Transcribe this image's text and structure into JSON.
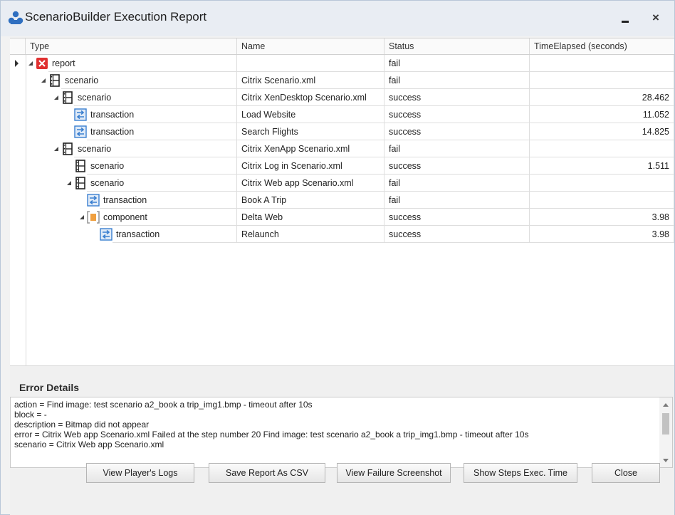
{
  "window": {
    "title": "ScenarioBuilder Execution Report",
    "minimize_icon": "minimize-icon",
    "close_icon": "×"
  },
  "grid": {
    "columns": [
      "Type",
      "Name",
      "Status",
      "TimeElapsed (seconds)"
    ],
    "rows": [
      {
        "type": "report",
        "icon": "error-icon",
        "name": "",
        "status": "fail",
        "time": ""
      },
      {
        "type": "scenario",
        "icon": "film-icon",
        "name": "Citrix Scenario.xml",
        "status": "fail",
        "time": ""
      },
      {
        "type": "scenario",
        "icon": "film-icon",
        "name": "Citrix XenDesktop Scenario.xml",
        "status": "success",
        "time": "28.462"
      },
      {
        "type": "transaction",
        "icon": "transaction-icon",
        "name": "Load Website",
        "status": "success",
        "time": "11.052"
      },
      {
        "type": "transaction",
        "icon": "transaction-icon",
        "name": "Search Flights",
        "status": "success",
        "time": "14.825"
      },
      {
        "type": "scenario",
        "icon": "film-icon",
        "name": "Citrix XenApp Scenario.xml",
        "status": "fail",
        "time": ""
      },
      {
        "type": "scenario",
        "icon": "film-icon",
        "name": "Citrix Log in Scenario.xml",
        "status": "success",
        "time": "1.511"
      },
      {
        "type": "scenario",
        "icon": "film-icon",
        "name": "Citrix Web app Scenario.xml",
        "status": "fail",
        "time": ""
      },
      {
        "type": "transaction",
        "icon": "transaction-icon",
        "name": "Book A Trip",
        "status": "fail",
        "time": ""
      },
      {
        "type": "component",
        "icon": "component-icon",
        "name": "Delta Web",
        "status": "success",
        "time": "3.98"
      },
      {
        "type": "transaction",
        "icon": "transaction-icon",
        "name": "Relaunch",
        "status": "success",
        "time": "3.98"
      }
    ]
  },
  "error_details": {
    "title": "Error Details",
    "lines": [
      "action = Find image: test scenario a2_book a trip_img1.bmp - timeout after 10s",
      "block = -",
      "description = Bitmap did not appear",
      "error = Citrix Web app Scenario.xml Failed at the step number 20 Find image: test scenario a2_book a trip_img1.bmp - timeout after 10s",
      "scenario = Citrix Web app Scenario.xml"
    ]
  },
  "buttons": {
    "view_logs": "View Player's Logs",
    "save_csv": "Save Report As CSV",
    "view_screenshot": "View Failure Screenshot",
    "show_steps": "Show Steps Exec. Time",
    "close": "Close"
  },
  "colors": {
    "error_red": "#e03030",
    "component_orange": "#f0a040",
    "transaction_blue": "#3a7fd0"
  }
}
